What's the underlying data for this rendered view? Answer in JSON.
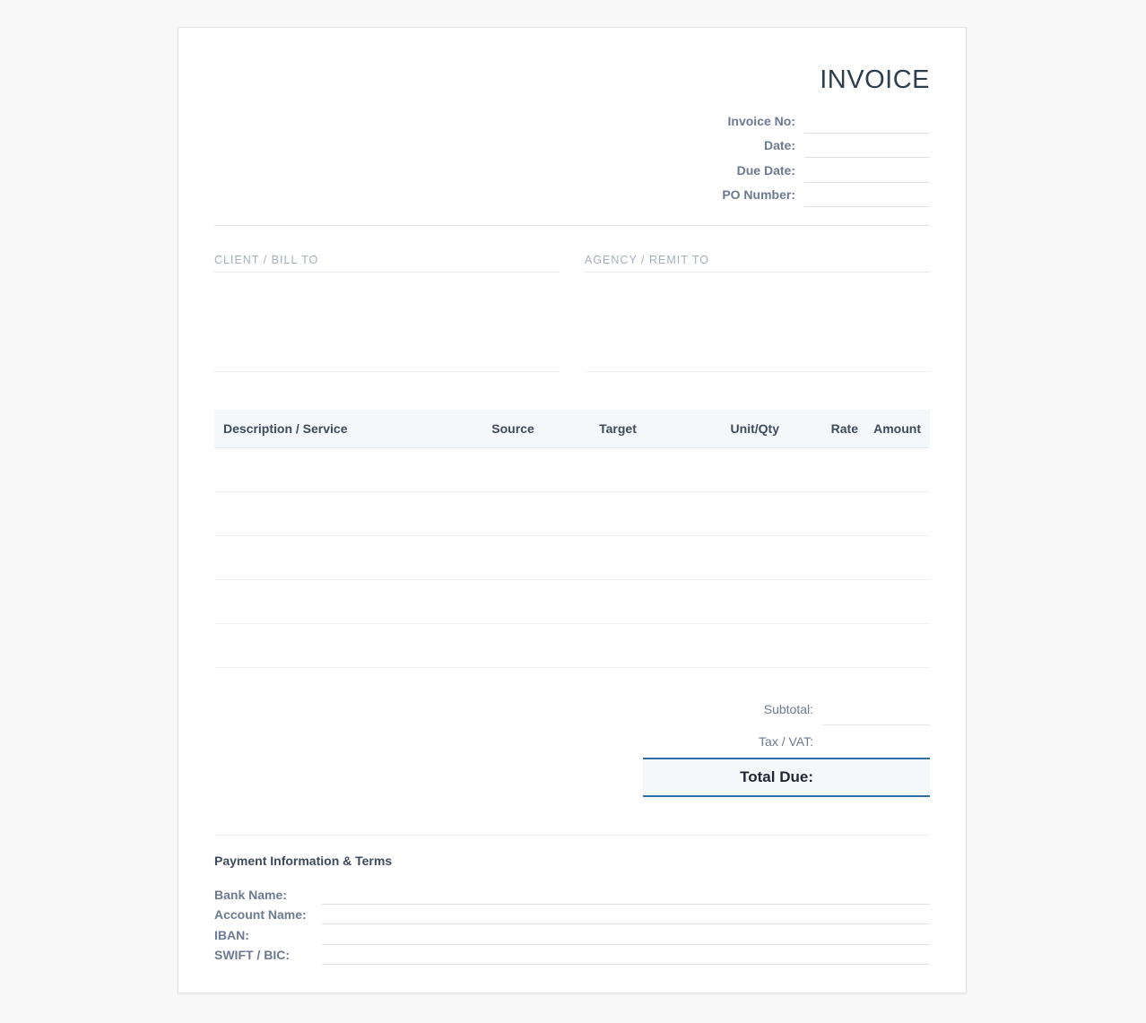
{
  "header": {
    "title": "INVOICE",
    "fields": [
      {
        "label": "Invoice No:",
        "value": ""
      },
      {
        "label": "Date:",
        "value": ""
      },
      {
        "label": "Due Date:",
        "value": ""
      },
      {
        "label": "PO Number:",
        "value": ""
      }
    ]
  },
  "parties": {
    "client_label": "CLIENT / BILL TO",
    "client_value": "",
    "agency_label": "AGENCY / REMIT TO",
    "agency_value": ""
  },
  "items": {
    "columns": [
      "Description / Service",
      "Source",
      "Target",
      "Unit/Qty",
      "Rate",
      "Amount"
    ],
    "rows": [
      [
        "",
        "",
        "",
        "",
        "",
        ""
      ],
      [
        "",
        "",
        "",
        "",
        "",
        ""
      ],
      [
        "",
        "",
        "",
        "",
        "",
        ""
      ],
      [
        "",
        "",
        "",
        "",
        "",
        ""
      ],
      [
        "",
        "",
        "",
        "",
        "",
        ""
      ]
    ]
  },
  "totals": {
    "subtotal_label": "Subtotal:",
    "subtotal_value": "",
    "tax_label": "Tax / VAT:",
    "tax_value": "",
    "total_label": "Total Due:",
    "total_value": ""
  },
  "payment": {
    "title": "Payment Information & Terms",
    "fields": [
      {
        "label": "Bank Name:",
        "value": ""
      },
      {
        "label": "Account Name:",
        "value": ""
      },
      {
        "label": "IBAN:",
        "value": ""
      },
      {
        "label": "SWIFT / BIC:",
        "value": ""
      }
    ]
  },
  "colors": {
    "accent": "#2f6ea4",
    "background": "#f8f8f8",
    "sheet": "#ffffff"
  }
}
